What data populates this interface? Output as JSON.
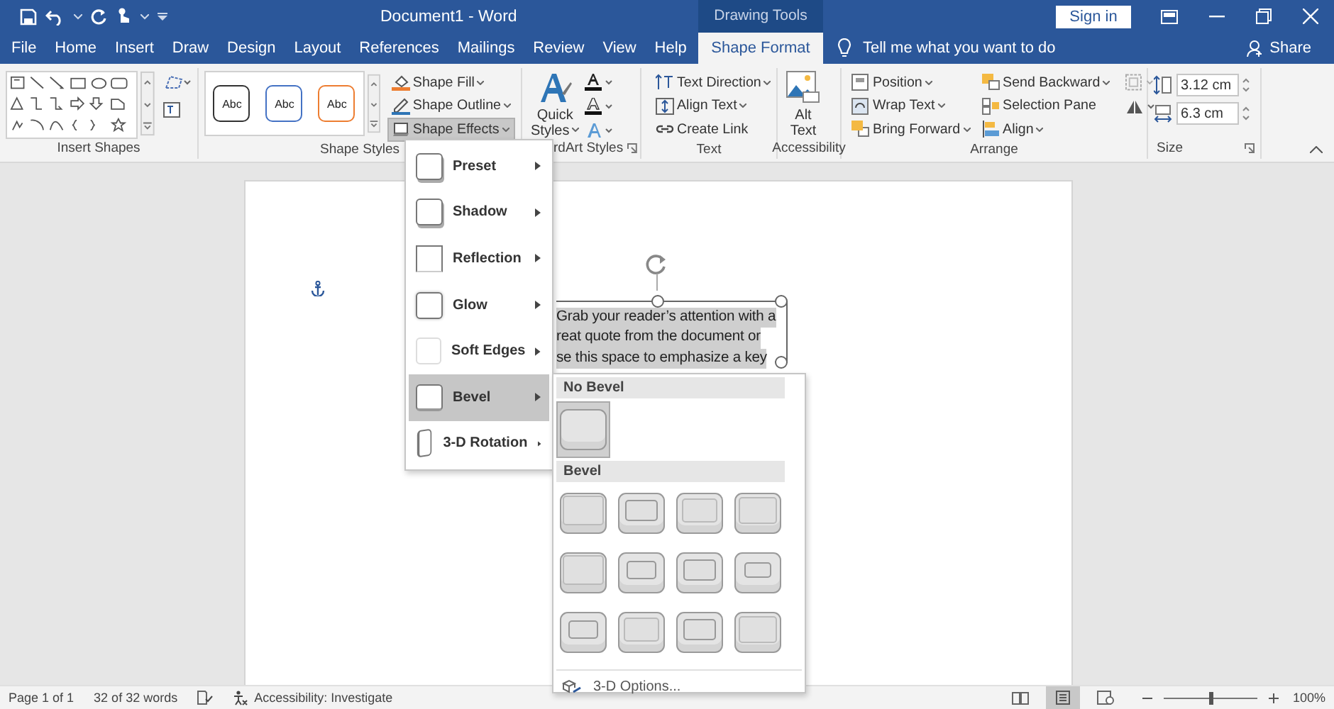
{
  "window": {
    "title": "Document1  -  Word",
    "context_label": "Drawing Tools",
    "sign_in": "Sign in"
  },
  "tabs": [
    {
      "label": "File",
      "kind": "standard",
      "selected": false
    },
    {
      "label": "Home",
      "kind": "standard",
      "selected": false
    },
    {
      "label": "Insert",
      "kind": "standard",
      "selected": false
    },
    {
      "label": "Draw",
      "kind": "standard",
      "selected": false
    },
    {
      "label": "Design",
      "kind": "standard",
      "selected": false
    },
    {
      "label": "Layout",
      "kind": "standard",
      "selected": false
    },
    {
      "label": "References",
      "kind": "standard",
      "selected": false
    },
    {
      "label": "Mailings",
      "kind": "standard",
      "selected": false
    },
    {
      "label": "Review",
      "kind": "standard",
      "selected": false
    },
    {
      "label": "View",
      "kind": "standard",
      "selected": false
    },
    {
      "label": "Help",
      "kind": "standard",
      "selected": false
    },
    {
      "label": "Shape Format",
      "kind": "context",
      "selected": true
    }
  ],
  "tell_me": {
    "placeholder": "Tell me what you want to do"
  },
  "share": "Share",
  "ribbon": {
    "insert_shapes": {
      "label": "Insert Shapes"
    },
    "shape_styles": {
      "label": "Shape Styles",
      "swatches": [
        {
          "text": "Abc",
          "color": "#333333"
        },
        {
          "text": "Abc",
          "color": "#4472c4"
        },
        {
          "text": "Abc",
          "color": "#ed7d31"
        }
      ],
      "commands": [
        {
          "label": "Shape Fill",
          "pressed": false
        },
        {
          "label": "Shape Outline",
          "pressed": false
        },
        {
          "label": "Shape Effects",
          "pressed": true
        }
      ]
    },
    "wordart_styles": {
      "label": "rdArt Styles",
      "quick_styles": [
        "Quick",
        "Styles"
      ]
    },
    "text": {
      "label": "Text",
      "commands": [
        {
          "label": "Text Direction",
          "dropdown": true
        },
        {
          "label": "Align Text",
          "dropdown": true
        },
        {
          "label": "Create Link",
          "dropdown": false
        }
      ]
    },
    "accessibility": {
      "label": "Accessibility",
      "alt_text": [
        "Alt",
        "Text"
      ]
    },
    "arrange": {
      "label": "Arrange",
      "commands": [
        {
          "label": "Position",
          "dropdown": true
        },
        {
          "label": "Wrap Text",
          "dropdown": true
        },
        {
          "label": "Bring Forward",
          "dropdown": true
        },
        {
          "label": "Send Backward",
          "dropdown": true
        },
        {
          "label": "Selection Pane",
          "dropdown": false
        },
        {
          "label": "Align",
          "dropdown": true
        }
      ]
    },
    "size": {
      "label": "Size",
      "height": "3.12 cm",
      "width": "6.3 cm"
    }
  },
  "document": {
    "text_box_lines": [
      "Grab your reader’s attention with a",
      "reat quote from the document or",
      "se this space to emphasize a key"
    ]
  },
  "shape_effects_menu": {
    "items": [
      {
        "label": "Preset",
        "selected": false
      },
      {
        "label": "Shadow",
        "selected": false
      },
      {
        "label": "Reflection",
        "selected": false
      },
      {
        "label": "Glow",
        "selected": false
      },
      {
        "label": "Soft Edges",
        "selected": false
      },
      {
        "label": "Bevel",
        "selected": true
      },
      {
        "label": "3-D Rotation",
        "selected": false
      }
    ]
  },
  "bevel_submenu": {
    "sections": [
      {
        "heading": "No Bevel",
        "presets": [
          {
            "selected": true
          }
        ]
      },
      {
        "heading": "Bevel",
        "presets": [
          {
            "selected": false
          },
          {
            "selected": false
          },
          {
            "selected": false
          },
          {
            "selected": false
          },
          {
            "selected": false
          },
          {
            "selected": false
          },
          {
            "selected": false
          },
          {
            "selected": false
          },
          {
            "selected": false
          },
          {
            "selected": false
          },
          {
            "selected": false
          },
          {
            "selected": false
          }
        ]
      }
    ],
    "options": "3-D Options..."
  },
  "status_bar": {
    "page": "Page 1 of 1",
    "words": "32 of 32 words",
    "accessibility": "Accessibility: Investigate",
    "views": [
      {
        "selected": false
      },
      {
        "selected": true
      },
      {
        "selected": false
      }
    ],
    "zoom": {
      "level": 0.5,
      "reading": "100%"
    }
  }
}
